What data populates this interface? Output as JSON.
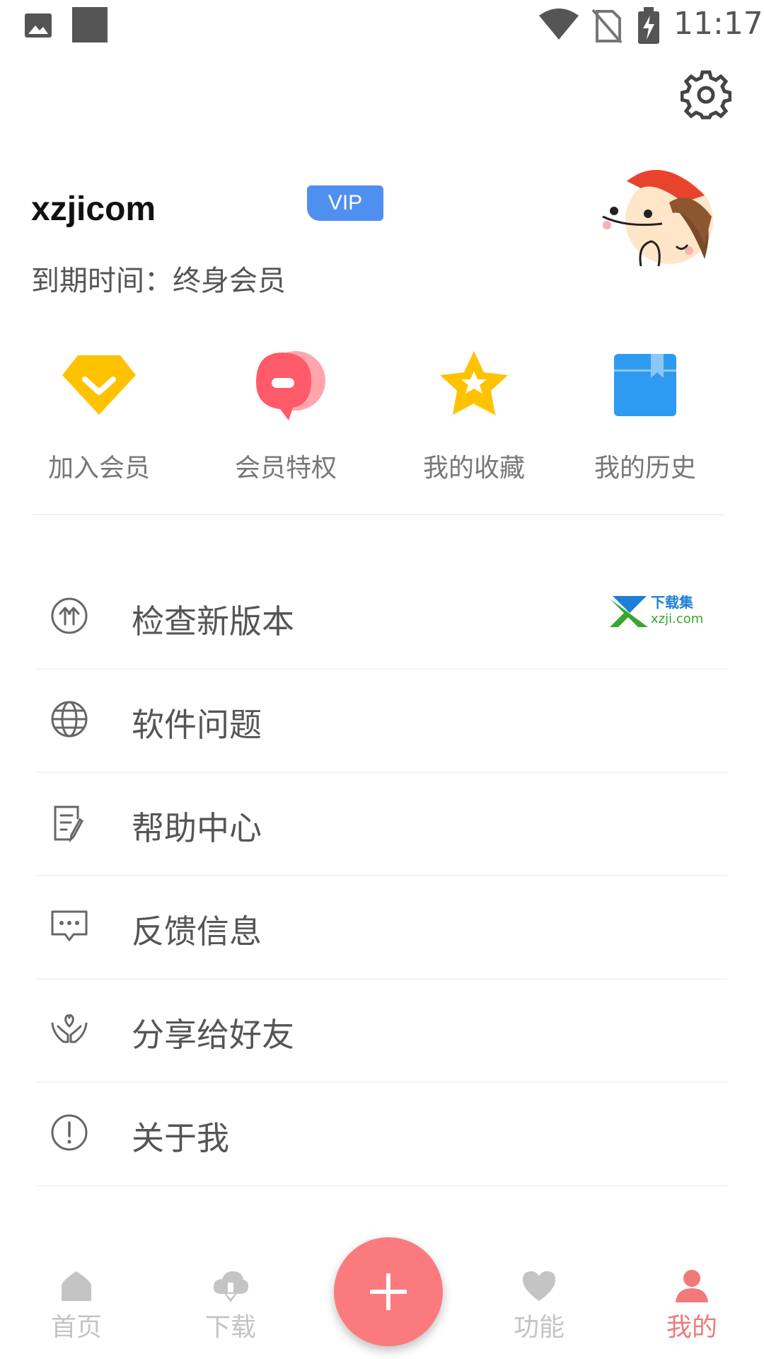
{
  "status_bar": {
    "time": "11:17"
  },
  "profile": {
    "username": "xzjicom",
    "vip_badge": "VIP",
    "expire_text": "到期时间：终身会员"
  },
  "quick_actions": [
    {
      "label": "加入会员",
      "icon": "diamond-icon",
      "color": "#ffc200"
    },
    {
      "label": "会员特权",
      "icon": "chat-bubble-icon",
      "color": "#ff5a6a"
    },
    {
      "label": "我的收藏",
      "icon": "star-icon",
      "color": "#ffc200"
    },
    {
      "label": "我的历史",
      "icon": "bookmark-box-icon",
      "color": "#2f9bf0"
    }
  ],
  "menu": [
    {
      "label": "检查新版本",
      "icon": "update-arrows-icon"
    },
    {
      "label": "软件问题",
      "icon": "globe-icon"
    },
    {
      "label": "帮助中心",
      "icon": "document-edit-icon"
    },
    {
      "label": "反馈信息",
      "icon": "message-dots-icon"
    },
    {
      "label": "分享给好友",
      "icon": "hands-heart-icon"
    },
    {
      "label": "关于我",
      "icon": "info-circle-icon"
    }
  ],
  "watermark": {
    "title": "下载集",
    "domain": "xzji.com"
  },
  "bottom_nav": [
    {
      "label": "首页",
      "icon": "home-icon",
      "active": false
    },
    {
      "label": "下载",
      "icon": "cloud-download-icon",
      "active": false
    },
    {
      "label": "功能",
      "icon": "heart-icon",
      "active": false
    },
    {
      "label": "我的",
      "icon": "user-icon",
      "active": true
    }
  ],
  "colors": {
    "accent": "#fb7a7e",
    "vip": "#4f8ff0",
    "inactive": "#c4c4c4",
    "active_tab": "#f07a7a"
  }
}
